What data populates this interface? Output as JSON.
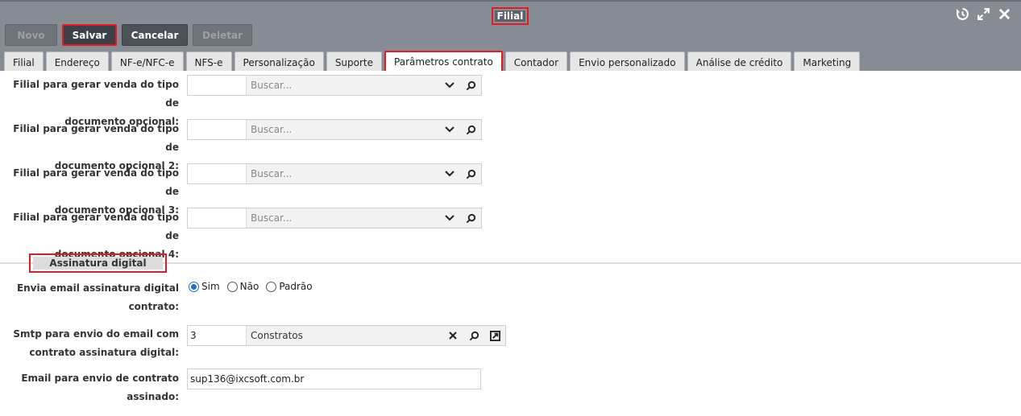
{
  "window": {
    "title": "Filial"
  },
  "toolbar": {
    "novo": "Novo",
    "salvar": "Salvar",
    "cancelar": "Cancelar",
    "deletar": "Deletar"
  },
  "tabs": [
    {
      "label": "Filial"
    },
    {
      "label": "Endereço"
    },
    {
      "label": "NF-e/NFC-e"
    },
    {
      "label": "NFS-e"
    },
    {
      "label": "Personalização"
    },
    {
      "label": "Suporte"
    },
    {
      "label": "Parâmetros contrato",
      "active": true
    },
    {
      "label": "Contador"
    },
    {
      "label": "Envio personalizado"
    },
    {
      "label": "Análise de crédito"
    },
    {
      "label": "Marketing"
    }
  ],
  "fields": {
    "filial_venda_1": {
      "label_line1": "Filial para gerar venda do tipo de",
      "label_line2": "documento opcional:",
      "code": "",
      "placeholder": "Buscar..."
    },
    "filial_venda_2": {
      "label_line1": "Filial para gerar venda do tipo de",
      "label_line2": "documento opcional 2:",
      "code": "",
      "placeholder": "Buscar..."
    },
    "filial_venda_3": {
      "label_line1": "Filial para gerar venda do tipo de",
      "label_line2": "documento opcional 3:",
      "code": "",
      "placeholder": "Buscar..."
    },
    "filial_venda_4": {
      "label_line1": "Filial para gerar venda do tipo de",
      "label_line2": "documento opcional 4:",
      "code": "",
      "placeholder": "Buscar..."
    }
  },
  "section": {
    "title": "Assinatura digital"
  },
  "email_assinatura": {
    "label_line1": "Envia email assinatura digital",
    "label_line2": "contrato:",
    "options": [
      "Sim",
      "Não",
      "Padrão"
    ],
    "selected": "Sim"
  },
  "smtp": {
    "label_line1": "Smtp para envio do email com",
    "label_line2": "contrato assinatura digital:",
    "code": "3",
    "value": "Constratos"
  },
  "email_envio": {
    "label_line1": "Email para envio de contrato",
    "label_line2": "assinado:",
    "value": "sup136@ixcsoft.com.br"
  },
  "colors": {
    "header_bg": "#868b94",
    "highlight": "#e01b24",
    "radio_accent": "#1f6fd1"
  }
}
